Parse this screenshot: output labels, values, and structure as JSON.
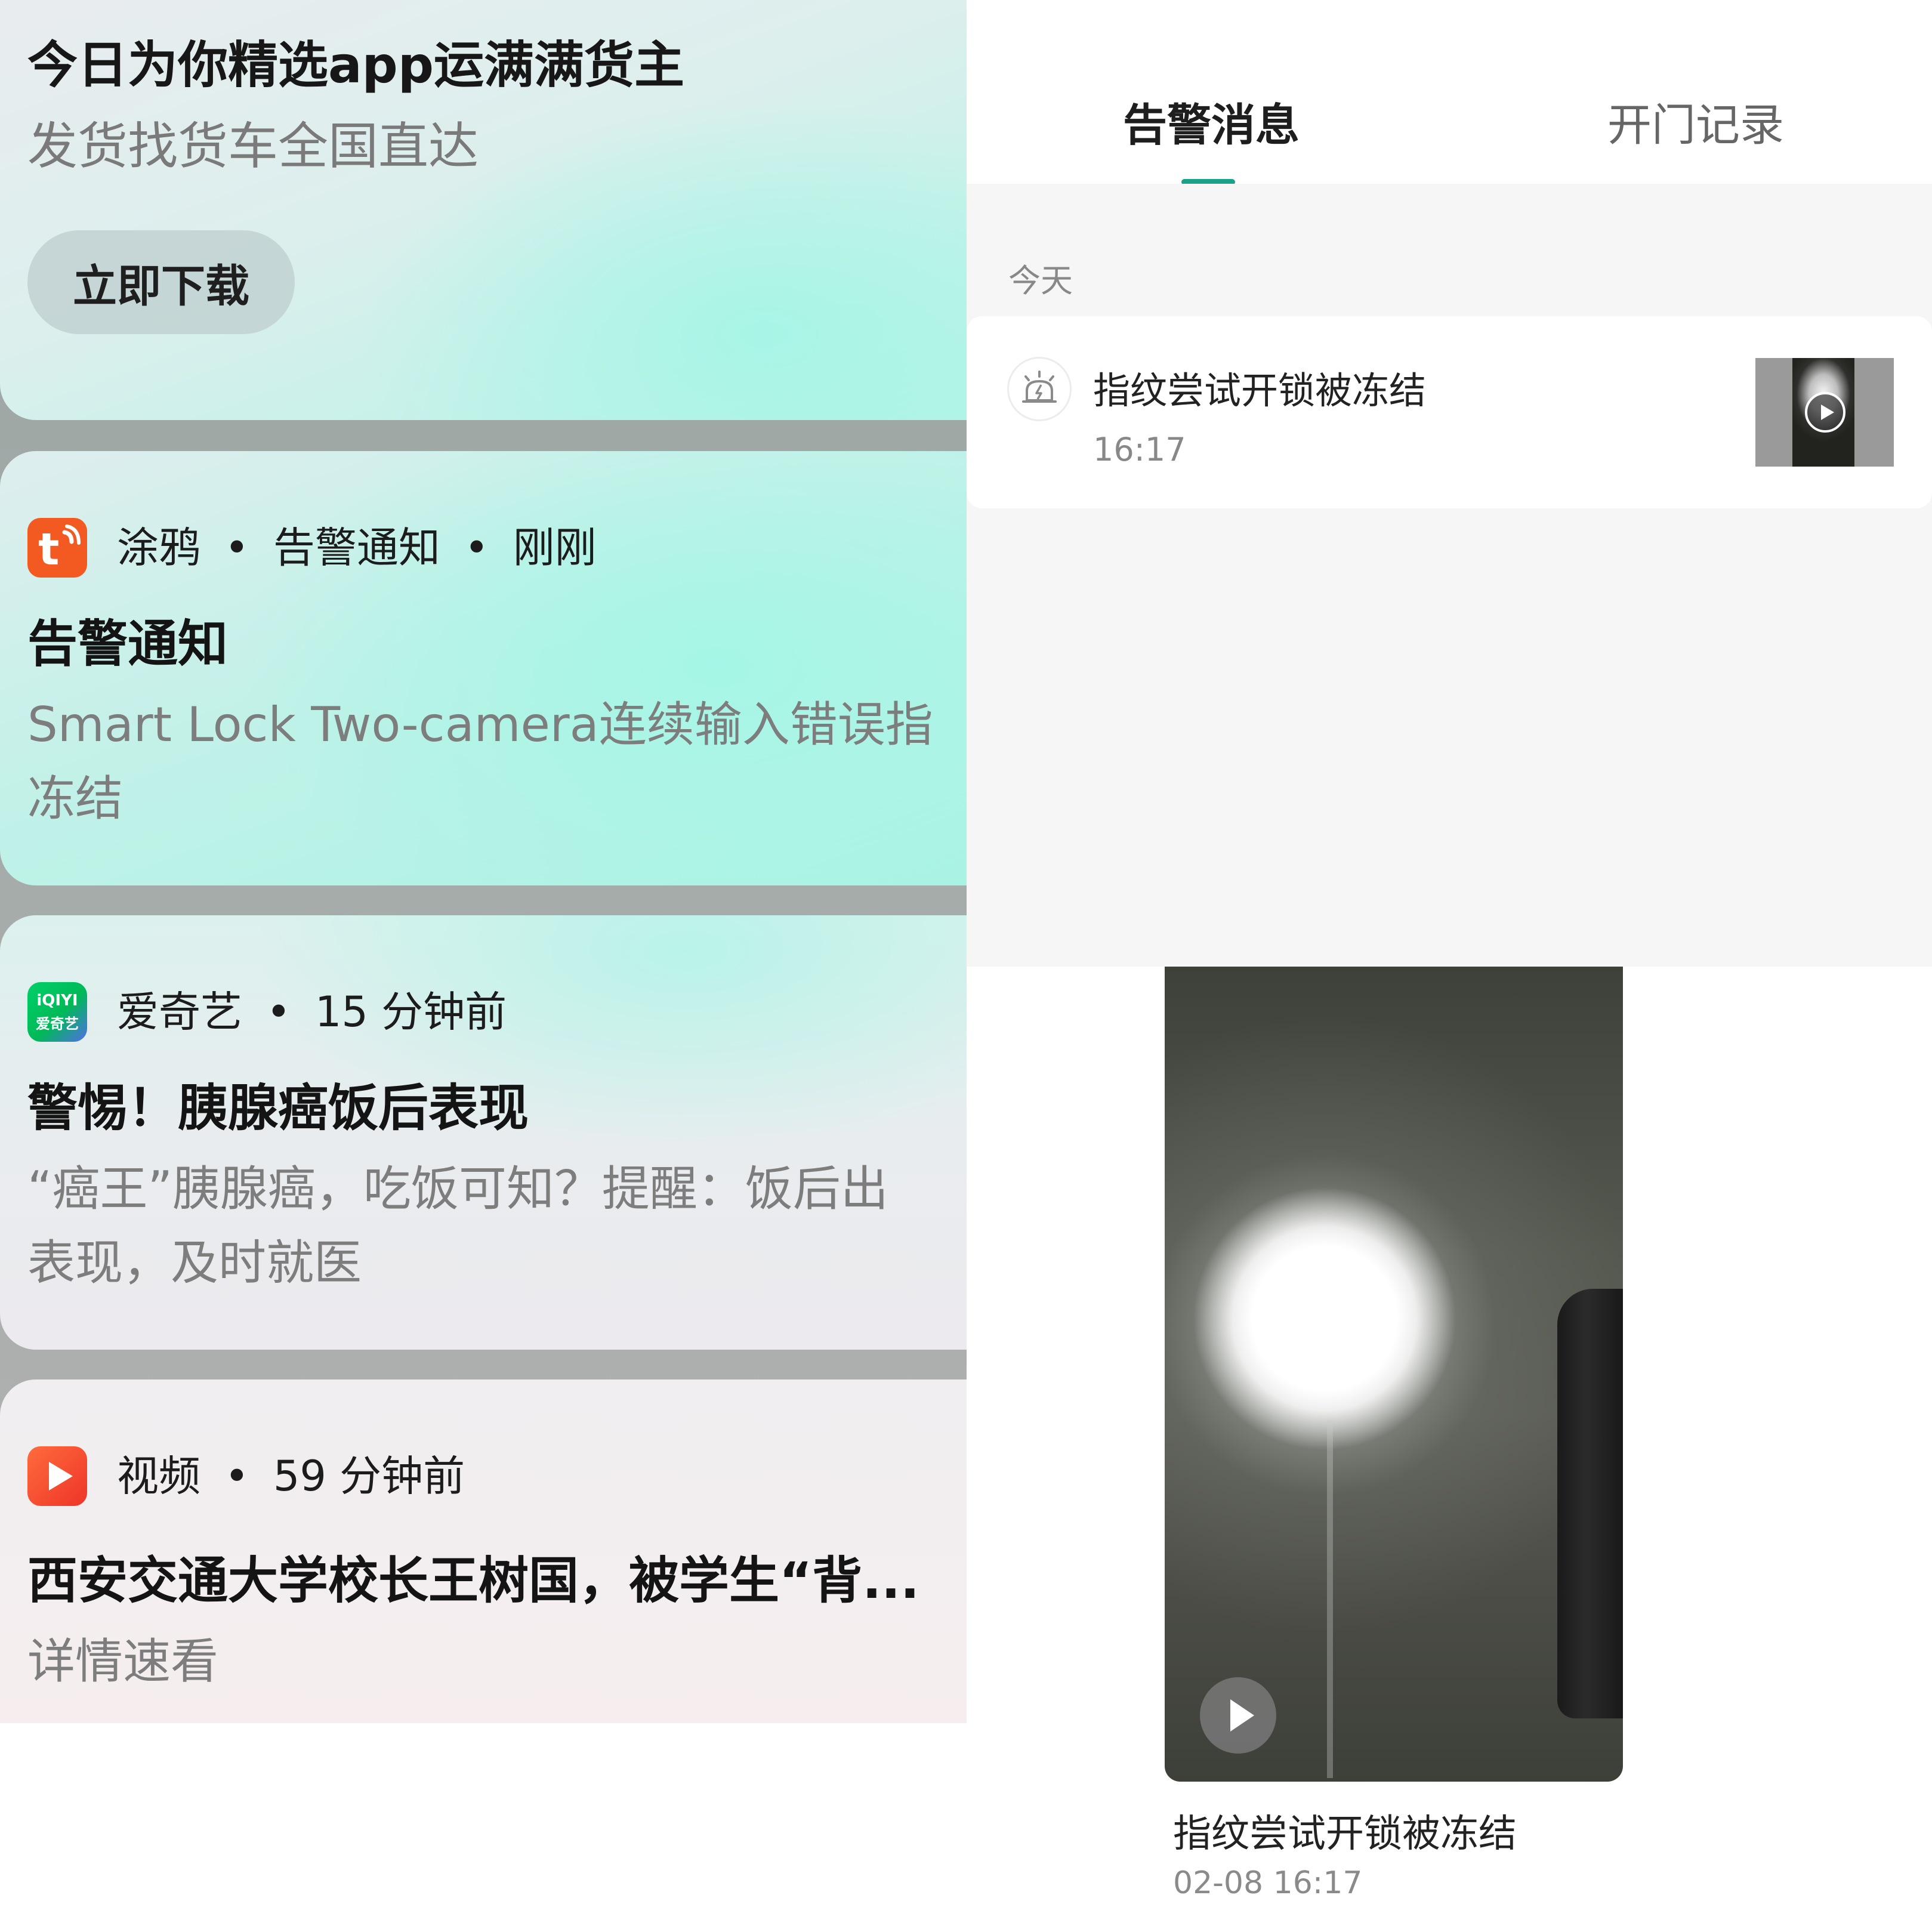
{
  "notifications": {
    "ad": {
      "title": "今日为你精选app运满满货主",
      "subtitle": "发货找货车全国直达",
      "button": "立即下载"
    },
    "tuya": {
      "app": "涂鸦",
      "category": "告警通知",
      "time": "刚刚",
      "title": "告警通知",
      "body_line1": "Smart Lock Two-camera连续输入错误指",
      "body_line2": "冻结",
      "icon": "tuya-app-icon",
      "icon_color": "#f25a22"
    },
    "iqiyi": {
      "app": "爱奇艺",
      "time": "15 分钟前",
      "title": "警惕！胰腺癌饭后表现",
      "body_line1": "“癌王”胰腺癌，吃饭可知？提醒：饭后出",
      "body_line2": "表现，及时就医",
      "icon": "iqiyi-app-icon",
      "icon_text_top": "iQIYI",
      "icon_text_bottom": "爱奇艺",
      "icon_color": "#00c35a"
    },
    "video": {
      "app": "视频",
      "time": "59 分钟前",
      "title": "西安交通大学校长王树国，被学生“背...",
      "body": "详情速看",
      "icon": "video-app-icon",
      "icon_color": "#f0442c"
    },
    "separator": "•"
  },
  "lock_app": {
    "tabs": [
      {
        "label": "告警消息",
        "active": true
      },
      {
        "label": "开门记录",
        "active": false
      }
    ],
    "accent_color": "#1aa18a",
    "section_label": "今天",
    "alarm_item": {
      "icon": "alarm-siren-icon",
      "title": "指纹尝试开锁被冻结",
      "time": "16:17",
      "thumbnail_icon": "play-icon"
    },
    "video_preview": {
      "caption": "指纹尝试开锁被冻结",
      "datetime": "02-08 16:17",
      "play_icon": "play-icon"
    }
  }
}
